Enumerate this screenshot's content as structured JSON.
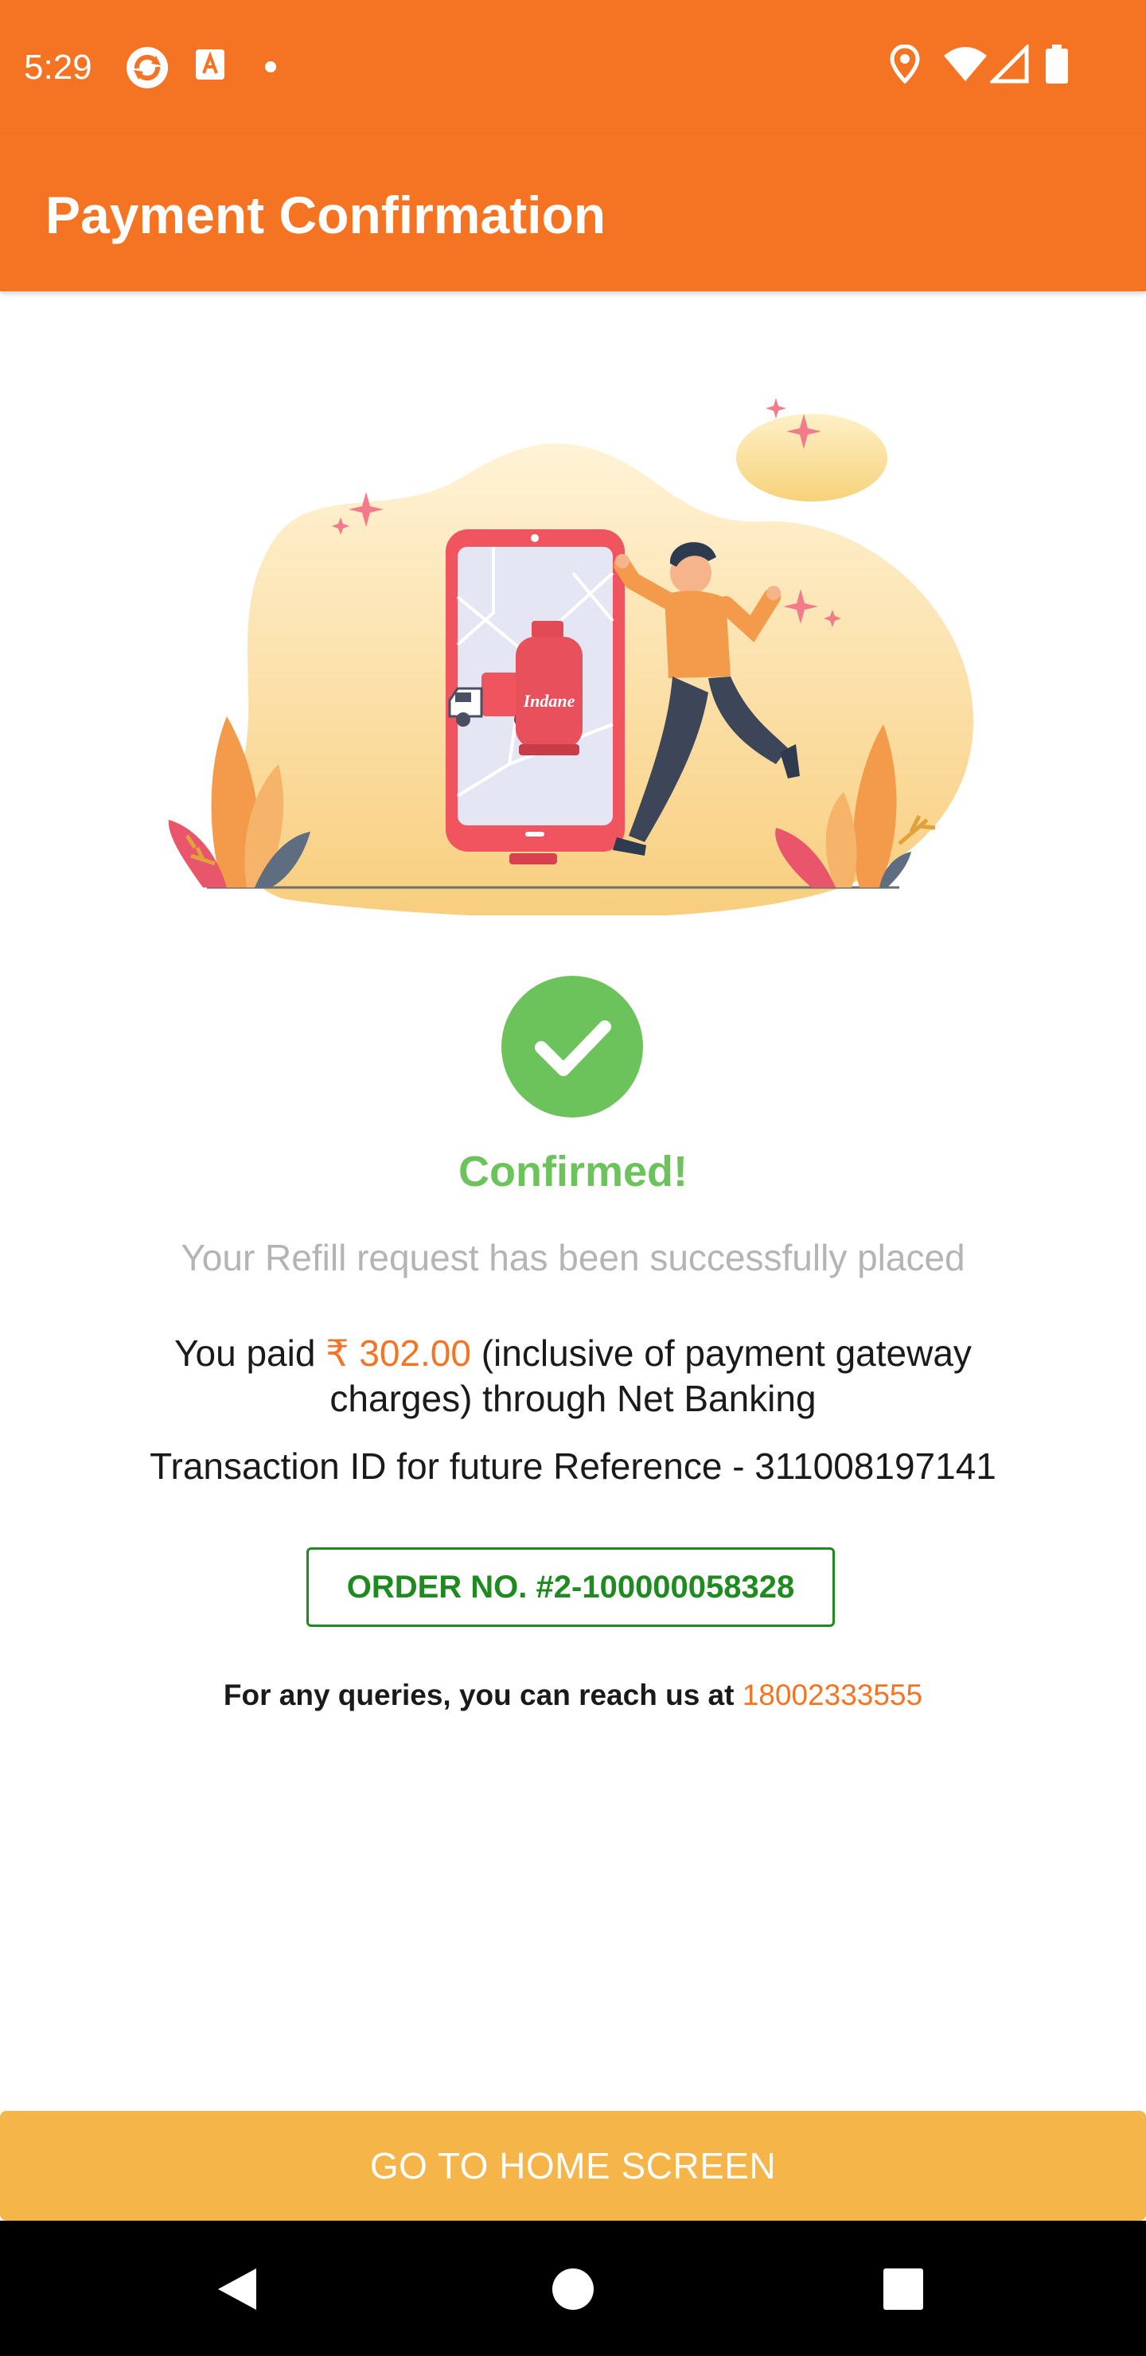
{
  "status_bar": {
    "time": "5:29"
  },
  "app_bar": {
    "title": "Payment Confirmation"
  },
  "illustration": {
    "cylinder_brand": "Indane"
  },
  "confirmation": {
    "heading": "Confirmed!",
    "subtitle": "Your Refill request has been successfully placed",
    "paid_prefix": "You paid ",
    "amount": "₹ 302.00",
    "paid_suffix": " (inclusive of payment gateway charges) through Net Banking",
    "transaction": "Transaction ID for future Reference - 311008197141",
    "order_number": "ORDER NO. #2-100000058328",
    "queries_prefix": "For any queries, you can reach us at ",
    "phone": "18002333555"
  },
  "actions": {
    "home_label": "GO TO HOME SCREEN"
  },
  "colors": {
    "brand_orange": "#F47424",
    "success_green": "#6CC35B",
    "order_green": "#1F8A1F",
    "button_yellow": "#F5B548"
  }
}
